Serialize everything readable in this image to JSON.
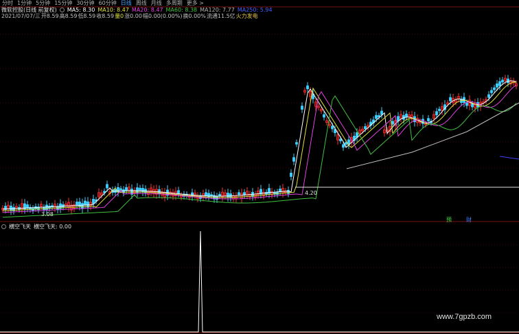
{
  "tabs": [
    {
      "label": "分时",
      "active": false
    },
    {
      "label": "1分钟",
      "active": false
    },
    {
      "label": "5分钟",
      "active": false
    },
    {
      "label": "15分钟",
      "active": false
    },
    {
      "label": "30分钟",
      "active": false
    },
    {
      "label": "60分钟",
      "active": false
    },
    {
      "label": "日线",
      "active": true
    },
    {
      "label": "周线",
      "active": false
    },
    {
      "label": "月线",
      "active": false
    },
    {
      "label": "多周期",
      "active": false
    },
    {
      "label": "更多 >",
      "active": false
    }
  ],
  "info_line1": {
    "stock_name": "微软控股(日线 前复权)",
    "ma5": "MA5: 8.30",
    "ma10": "MA10: 8.47",
    "ma20": "MA20: 8.47",
    "ma60": "MA60: 8.38",
    "ma120": "MA120: 7.77",
    "ma250": "MA250: 5.94"
  },
  "info_line2": {
    "date": "2021/07/07/三",
    "open": "开8.59",
    "high": "高8.59",
    "low": "低8.59",
    "close": "收8.59",
    "volume": "量0",
    "change": "涨0.00",
    "pct": "幅0.00(0.00%)",
    "turnover": "换0.00%",
    "float": "流通11.5亿",
    "concept": "火力发电"
  },
  "price_labels": {
    "low_label": "3.08",
    "mid_label": "4.20"
  },
  "markers": [
    {
      "label": "预",
      "color": "#40e040"
    },
    {
      "label": "财",
      "color": "#4080ff"
    }
  ],
  "sub_panel": {
    "indicator_name": "横空飞天",
    "value_label": "横空飞天: 0.00"
  },
  "watermark": "www.7gpzb.com",
  "colors": {
    "up": "#ff3030",
    "down": "#40d0ff",
    "ma5": "#ffffff",
    "ma10": "#e0e040",
    "ma20": "#e040e0",
    "ma60": "#40c040",
    "ma120": "#808080",
    "ma250": "#4040ff"
  }
}
